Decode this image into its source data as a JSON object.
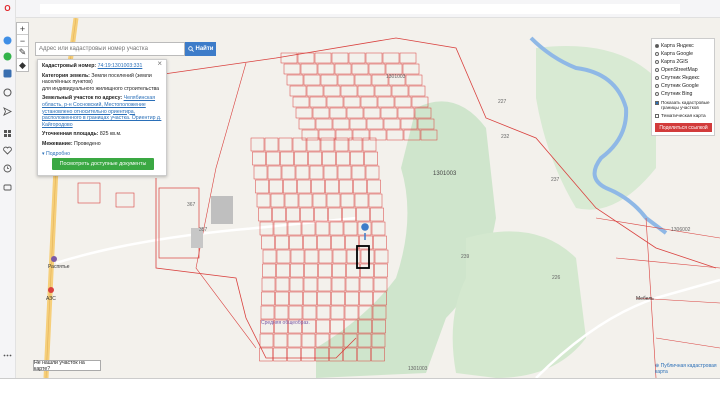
{
  "search": {
    "placeholder": "Адрес или кадастровый номер участка",
    "button_label": "Найти"
  },
  "zoom": {
    "plus": "+",
    "minus": "−"
  },
  "info_card": {
    "cadastral_number_label": "Кадастровый номер:",
    "cadastral_number_value": "74:19:1301003:331",
    "category_label": "Категория земель:",
    "category_value": "Земли поселений (земли населённых пунктов)",
    "use_value": "для индивидуального жилищного строительства",
    "address_label": "Земельный участок по адресу:",
    "address_value": "Челябинская область, р-н Сосновский, Местоположение установлено относительно ориентира, расположенного в границах участка. Ориентир д. Кайгородово",
    "area_label": "Уточненная площадь:",
    "area_value": "825 кв.м.",
    "survey_label": "Межевание:",
    "survey_value": "Проведено",
    "more_link": "Подробно",
    "docs_button": "Посмотреть доступные документы",
    "close_symbol": "×"
  },
  "layers": {
    "options": [
      "Карта Яндекс",
      "Карта Google",
      "Карта 2GIS",
      "OpenStreetMap",
      "Спутник Яндекс",
      "Спутник Google",
      "Спутник Bing"
    ],
    "selected": 0,
    "show_borders": "Показать кадастровые границы участков",
    "thematic": "Тематическая карта",
    "share_button": "Поделиться ссылкой"
  },
  "bottom_button": "Не нашли участок на карте?",
  "attribution": "Публичная кадастровая карта",
  "map_labels": {
    "quarter_main": "1301003",
    "quarter_top": "1301003",
    "quarter_right": "1306002",
    "quarter_bottom": "1301003",
    "num_237": "237",
    "num_232": "232",
    "num_239": "239",
    "num_226": "226",
    "num_227": "227",
    "num_367": "367",
    "num_357": "357",
    "place_raspyat": "Распятье",
    "place_azs": "АЗС",
    "place_school": "Средняя общеобраз.",
    "place_mebel": "Мебель"
  },
  "colors": {
    "parcel_line": "#d9413e",
    "forest": "#cfe5cc",
    "river": "#8fb8e6",
    "road": "#f6cf7a",
    "accent": "#3d7cc9",
    "share": "#d23b3b",
    "docs": "#3aa843"
  }
}
